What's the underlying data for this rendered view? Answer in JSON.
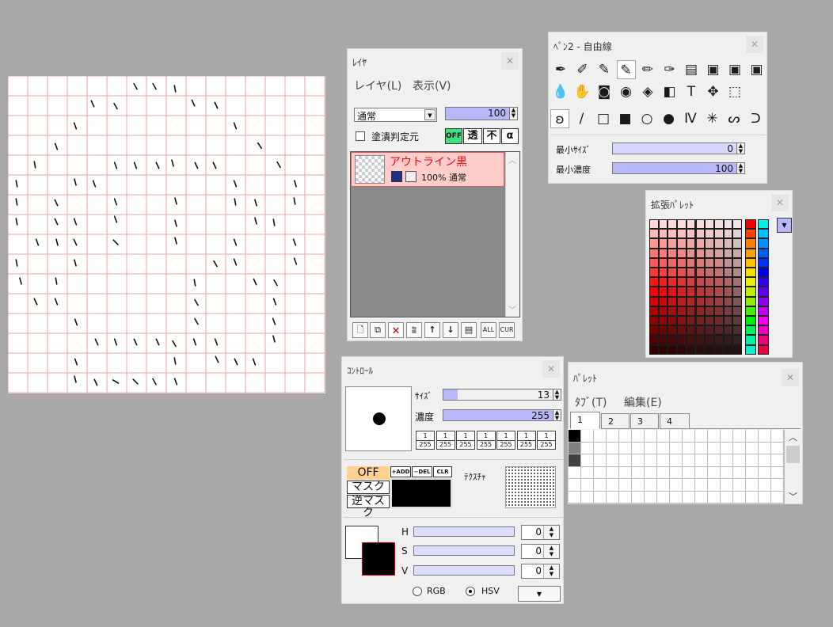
{
  "layer_window": {
    "title": "ﾚｲﾔ",
    "menu": [
      "レイヤ(L)",
      "表示(V)"
    ],
    "blend_mode": "通常",
    "opacity": "100",
    "checkbox_label": "塗潰判定元",
    "toggles": [
      "OFF",
      "透",
      "不",
      "α"
    ],
    "layer": {
      "name": "アウトライン黒",
      "info": "100% 通常"
    },
    "bottom_buttons": [
      "new",
      "copy",
      "delete",
      "merge",
      "up",
      "down",
      "props",
      "ALL",
      "CUR"
    ]
  },
  "pen_window": {
    "title": "ﾍﾟﾝ2 - 自由線",
    "tools_row1": [
      "✒",
      "✐",
      "✎",
      "✎",
      "✏",
      "✑",
      "▤",
      "▣",
      "▣",
      "▣"
    ],
    "tools_row2": [
      "💧",
      "✋",
      "◙",
      "◉",
      "◈",
      "◧",
      "T",
      "✥",
      "⬚"
    ],
    "shapes": [
      "ʚ",
      "/",
      "□",
      "■",
      "○",
      "●",
      "Ⅳ",
      "✳",
      "ᔕ",
      "ᑐ"
    ],
    "min_size_label": "最小ｻｲｽﾞ",
    "min_size_value": "0",
    "min_density_label": "最小濃度",
    "min_density_value": "100"
  },
  "extended_palette": {
    "title": "拡張ﾊﾟﾚｯﾄ"
  },
  "control_window": {
    "title": "ｺﾝﾄﾛｰﾙ",
    "size_label": "ｻｲｽﾞ",
    "size_value": "13",
    "density_label": "濃度",
    "density_value": "255",
    "presets": [
      "1/255",
      "1/255",
      "1/255",
      "1/255",
      "1/255",
      "1/255",
      "1/255"
    ],
    "mask_buttons": [
      "OFF",
      "マスク",
      "逆マスク"
    ],
    "mask_ops": [
      "+ADD",
      "−DEL",
      "CLR"
    ],
    "texture_label": "ﾃｸｽﾁｬ",
    "hsv_labels": [
      "H",
      "S",
      "V"
    ],
    "hsv_values": [
      "0",
      "0",
      "0"
    ],
    "mode_rgb": "RGB",
    "mode_hsv": "HSV"
  },
  "palette_window": {
    "title": "ﾊﾟﾚｯﾄ",
    "menu": [
      "ﾀﾌﾞ(T)",
      "編集(E)"
    ],
    "tabs": [
      "1",
      "2",
      "3",
      "4"
    ]
  },
  "colors": {
    "accent_spin": "#b8b8f8",
    "layer_selected": "#ffcccc",
    "layer_name": "#e01010",
    "grid_line": "#e8a0a0",
    "mask_off": "#ffd090",
    "toggle_off": "#40e080"
  }
}
